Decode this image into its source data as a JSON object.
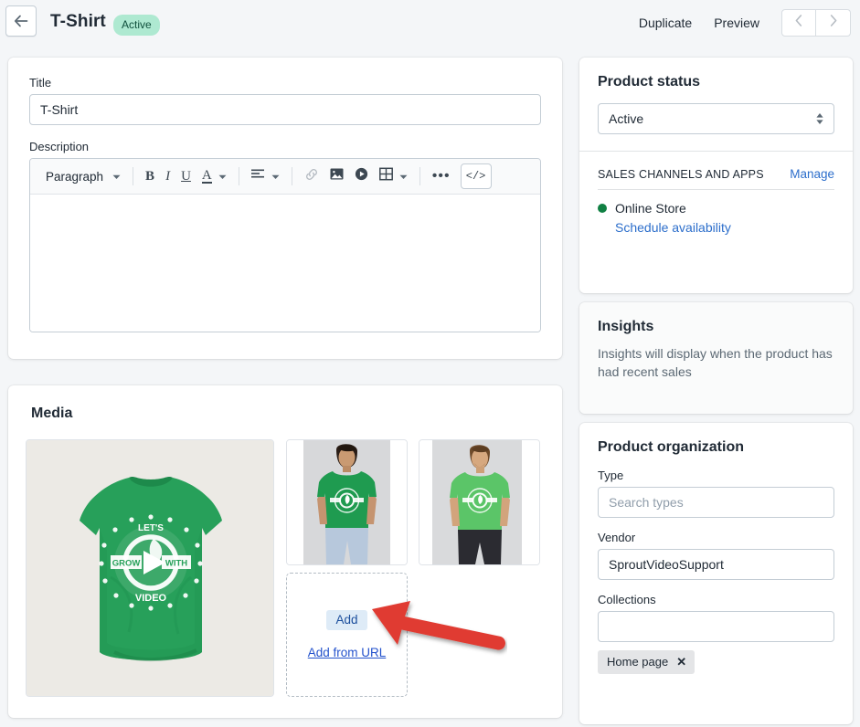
{
  "header": {
    "back_icon": "arrow-left-icon",
    "title": "T-Shirt",
    "status_badge": "Active",
    "duplicate_label": "Duplicate",
    "preview_label": "Preview",
    "prev_icon": "chevron-left-icon",
    "next_icon": "chevron-right-icon"
  },
  "details": {
    "title_label": "Title",
    "title_value": "T-Shirt",
    "description_label": "Description",
    "toolbar": {
      "block_format": "Paragraph",
      "bold": "B",
      "italic": "I",
      "underline": "U",
      "text_color": "A",
      "align_icon": "align-left-icon",
      "link_icon": "link-icon",
      "image_icon": "image-icon",
      "video_icon": "video-play-icon",
      "table_icon": "table-icon",
      "more_icon": "ellipsis-icon",
      "code_label": "</>"
    },
    "description_value": ""
  },
  "media": {
    "heading": "Media",
    "main_image_alt": "green t-shirt with Let's Grow With Video logo",
    "shirt_art": {
      "top_word": "LET'S",
      "left_word": "GROW",
      "right_word": "WITH",
      "bottom_word": "VIDEO"
    },
    "thumb1_alt": "model wearing dark green t-shirt",
    "thumb2_alt": "model wearing light green t-shirt",
    "add_label": "Add",
    "add_from_url_label": "Add from URL"
  },
  "product_status": {
    "heading": "Product status",
    "status_value": "Active",
    "channels_label": "SALES CHANNELS AND APPS",
    "manage_label": "Manage",
    "channel_name": "Online Store",
    "channel_dot_color": "#108043",
    "schedule_label": "Schedule availability"
  },
  "insights": {
    "heading": "Insights",
    "body": "Insights will display when the product has had recent sales"
  },
  "organization": {
    "heading": "Product organization",
    "type_label": "Type",
    "type_placeholder": "Search types",
    "type_value": "",
    "vendor_label": "Vendor",
    "vendor_value": "SproutVideoSupport",
    "collections_label": "Collections",
    "collections_value": "",
    "collection_chip": "Home page",
    "chip_remove_icon": "✕"
  },
  "annotation": {
    "arrow_color": "#e03b30",
    "points_to": "Add"
  }
}
